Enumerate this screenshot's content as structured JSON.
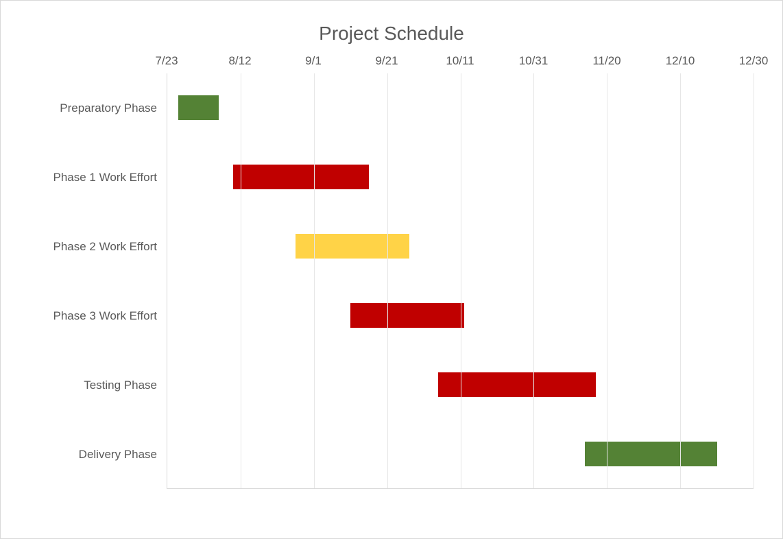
{
  "chart_data": {
    "type": "gantt",
    "title": "Project Schedule",
    "x_ticks": [
      "7/23",
      "8/12",
      "9/1",
      "9/21",
      "10/11",
      "10/31",
      "11/20",
      "12/10",
      "12/30"
    ],
    "x_range_days": [
      0,
      160
    ],
    "tick_day_positions": [
      0,
      20,
      40,
      60,
      80,
      100,
      120,
      140,
      160
    ],
    "categories": [
      "Preparatory Phase",
      "Phase 1 Work Effort",
      "Phase 2 Work Effort",
      "Phase 3 Work Effort",
      "Testing Phase",
      "Delivery Phase"
    ],
    "series": [
      {
        "name": "Preparatory Phase",
        "start": "7/26",
        "end": "8/6",
        "start_day": 3,
        "duration_days": 11,
        "color": "#548235"
      },
      {
        "name": "Phase 1 Work Effort",
        "start": "8/10",
        "end": "9/16",
        "start_day": 18,
        "duration_days": 37,
        "color": "#c00000"
      },
      {
        "name": "Phase 2 Work Effort",
        "start": "8/27",
        "end": "9/27",
        "start_day": 35,
        "duration_days": 31,
        "color": "#ffd347"
      },
      {
        "name": "Phase 3 Work Effort",
        "start": "9/11",
        "end": "10/12",
        "start_day": 50,
        "duration_days": 31,
        "color": "#c00000"
      },
      {
        "name": "Testing Phase",
        "start": "10/5",
        "end": "11/17",
        "start_day": 74,
        "duration_days": 43,
        "color": "#c00000"
      },
      {
        "name": "Delivery Phase",
        "start": "11/14",
        "end": "12/20",
        "start_day": 114,
        "duration_days": 36,
        "color": "#548235"
      }
    ],
    "colors": {
      "green": "#548235",
      "red": "#c00000",
      "yellow": "#ffd347"
    }
  }
}
